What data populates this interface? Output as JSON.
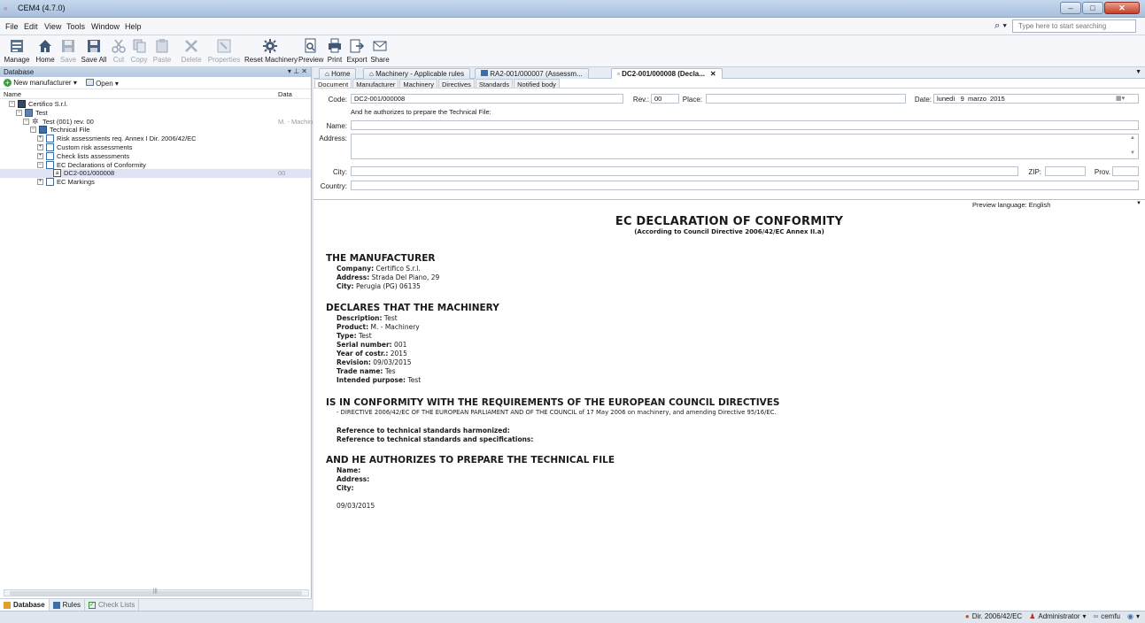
{
  "window": {
    "title": "CEM4 (4.7.0)"
  },
  "menu": [
    "File",
    "Edit",
    "View",
    "Tools",
    "Window",
    "Help"
  ],
  "search": {
    "placeholder": "Type here to start searching"
  },
  "toolbar": {
    "manage": "Manage",
    "home": "Home",
    "save": "Save",
    "save_all": "Save All",
    "cut": "Cut",
    "copy": "Copy",
    "paste": "Paste",
    "delete": "Delete",
    "properties": "Properties",
    "reset_machinery": "Reset Machinery",
    "preview": "Preview",
    "print": "Print",
    "export": "Export",
    "share": "Share"
  },
  "left": {
    "pane_title": "Database",
    "new_manufacturer": "New manufacturer",
    "open": "Open",
    "col_name": "Name",
    "col_data": "Data",
    "tree": [
      {
        "label": "Certifico S.r.l.",
        "data": ""
      },
      {
        "label": "Test",
        "data": ""
      },
      {
        "label": "Test (001) rev. 00",
        "data": "M. - Machin"
      },
      {
        "label": "Technical File",
        "data": ""
      },
      {
        "label": "Risk assessments req. Annex I Dir. 2006/42/EC",
        "data": ""
      },
      {
        "label": "Custom risk assessments",
        "data": ""
      },
      {
        "label": "Check lists assessments",
        "data": ""
      },
      {
        "label": "EC Declarations of Conformity",
        "data": ""
      },
      {
        "label": "DC2-001/000008",
        "data": "00"
      },
      {
        "label": "EC Markings",
        "data": ""
      }
    ],
    "bottom_tabs": [
      "Database",
      "Rules",
      "Check Lists"
    ]
  },
  "doc_tabs": [
    "Home",
    "Machinery - Applicable rules",
    "RA2-001/000007 (Assessm...",
    "DC2-001/000008 (Decla..."
  ],
  "sub_tabs": [
    "Document",
    "Manufacturer",
    "Machinery",
    "Directives",
    "Standards",
    "Notified body"
  ],
  "form": {
    "code_label": "Code:",
    "code_value": "DC2-001/000008",
    "rev_label": "Rev.:",
    "rev_value": "00",
    "place_label": "Place:",
    "place_value": "",
    "date_label": "Date:",
    "date_value": "lunedì   9  marzo  2015",
    "authorize_note": "And he authorizes to prepare the Technical File:",
    "name_label": "Name:",
    "address_label": "Address:",
    "city_label": "City:",
    "zip_label": "ZIP:",
    "prov_label": "Prov.",
    "country_label": "Country:"
  },
  "preview_language": "Preview language: English",
  "preview": {
    "title": "EC DECLARATION OF CONFORMITY",
    "subtitle": "(According to Council Directive 2006/42/EC Annex II.a)",
    "manufacturer_heading": "THE MANUFACTURER",
    "company_k": "Company:",
    "company_v": "Certifico S.r.l.",
    "address_k": "Address:",
    "address_v": "Strada Del Piano, 29",
    "city_k": "City:",
    "city_v": "Perugia (PG) 06135",
    "machinery_heading": "DECLARES THAT THE MACHINERY",
    "description_k": "Description:",
    "description_v": "Test",
    "product_k": "Product:",
    "product_v": "M. - Machinery",
    "type_k": "Type:",
    "type_v": "Test",
    "serial_k": "Serial number:",
    "serial_v": "001",
    "year_k": "Year of costr.:",
    "year_v": "2015",
    "revision_k": "Revision:",
    "revision_v": "09/03/2015",
    "trade_k": "Trade name:",
    "trade_v": "Tes",
    "purpose_k": "Intended purpose:",
    "purpose_v": "Test",
    "conformity_heading": "IS IN CONFORMITY WITH THE REQUIREMENTS OF THE EUROPEAN COUNCIL DIRECTIVES",
    "directive_line": "- DIRECTIVE 2006/42/EC OF THE EUROPEAN PARLIAMENT AND OF THE COUNCIL of 17 May 2006 on machinery, and amending Directive 95/16/EC.",
    "ref_harmonized": "Reference to technical standards harmonized:",
    "ref_specs": "Reference to technical standards and specifications:",
    "authorize_heading": "AND HE AUTHORIZES TO PREPARE THE TECHNICAL FILE",
    "auth_name": "Name:",
    "auth_address": "Address:",
    "auth_city": "City:",
    "date": "09/03/2015"
  },
  "status": {
    "directive": "Dir. 2006/42/EC",
    "user": "Administrator",
    "account": "cemfu"
  }
}
